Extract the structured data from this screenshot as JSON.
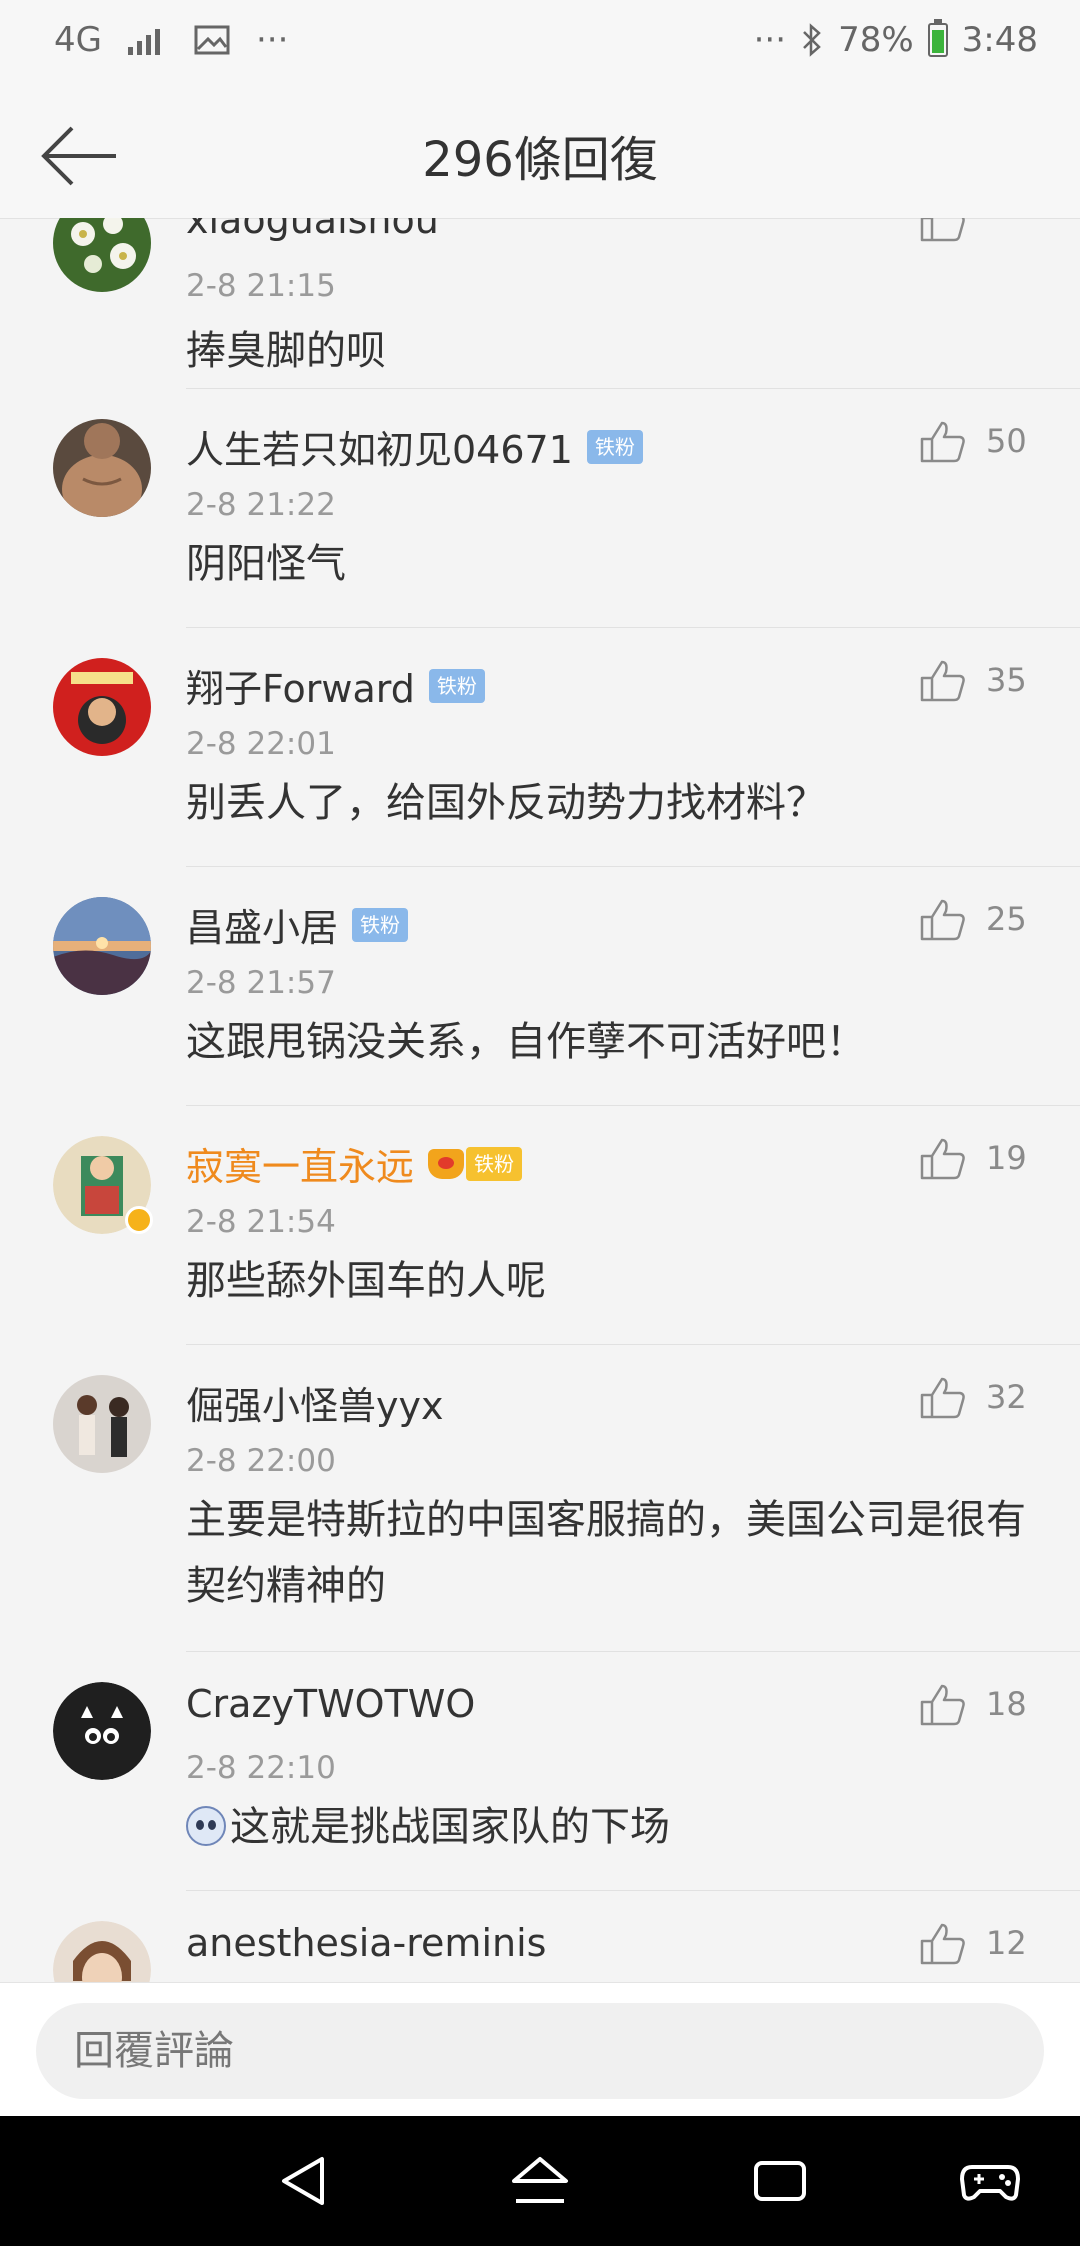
{
  "status_bar": {
    "network": "4G",
    "more_left": "···",
    "more_right": "···",
    "battery": "78%",
    "time": "3:48"
  },
  "header": {
    "title": "296條回復"
  },
  "comments": [
    {
      "user": "xiaoguaishou",
      "badge": "",
      "time": "2-8 21:15",
      "text": "捧臭脚的呗",
      "likes": "",
      "vip": false
    },
    {
      "user": "人生若只如初见04671",
      "badge": "铁粉",
      "time": "2-8 21:22",
      "text": "阴阳怪气",
      "likes": "50",
      "vip": false
    },
    {
      "user": "翔子Forward",
      "badge": "铁粉",
      "time": "2-8 22:01",
      "text": "别丢人了，给国外反动势力找材料？",
      "likes": "35",
      "vip": false
    },
    {
      "user": "昌盛小居",
      "badge": "铁粉",
      "time": "2-8 21:57",
      "text": "这跟甩锅没关系，自作孽不可活好吧！",
      "likes": "25",
      "vip": false
    },
    {
      "user": "寂寞一直永远",
      "badge": "铁粉",
      "time": "2-8 21:54",
      "text": "那些舔外国车的人呢",
      "likes": "19",
      "vip": true
    },
    {
      "user": "倔强小怪兽yyx",
      "badge": "",
      "time": "2-8 22:00",
      "text": "主要是特斯拉的中国客服搞的，美国公司是很有契约精神的",
      "likes": "32",
      "vip": false
    },
    {
      "user": "CrazyTWOTWO",
      "badge": "",
      "time": "2-8 22:10",
      "text": "这就是挑战国家队的下场",
      "likes": "18",
      "vip": false
    },
    {
      "user": "anesthesia-reminis",
      "badge": "",
      "time": "",
      "text": "",
      "likes": "12",
      "vip": false
    }
  ],
  "reply_bar": {
    "placeholder": "回覆評論"
  },
  "colors": {
    "background": "#f4f4f4",
    "vip_name": "#ef8a1d",
    "fan_badge": "#8ab8ea",
    "nav_bar": "#000000"
  }
}
